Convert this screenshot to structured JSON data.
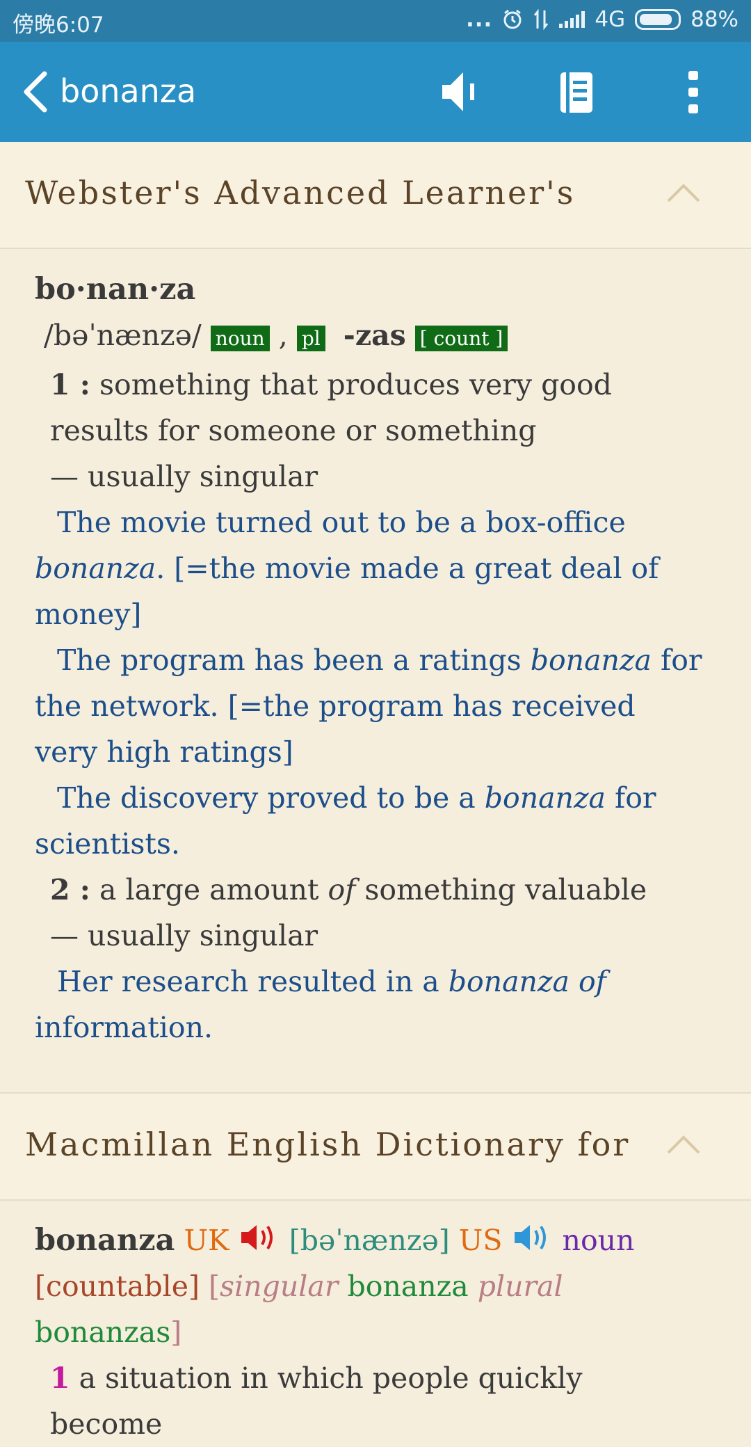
{
  "status": {
    "time": "傍晚6:07",
    "dots": "...",
    "network": "4G",
    "battery": "88%"
  },
  "appbar": {
    "title": "bonanza",
    "icons": [
      "back-icon",
      "speaker-icon",
      "list-icon",
      "more-icon"
    ]
  },
  "colors": {
    "status_bar": "#2b7ca6",
    "app_bar": "#2890c5",
    "background": "#f5eedd",
    "example_text": "#1c4e8a",
    "tag": "#0f6b16"
  },
  "webster": {
    "section_title": "Webster's Advanced Learner's",
    "headword": "bo·nan·za",
    "pronunciation": "/bəˈnænzə/",
    "pos": "noun",
    "comma": ",",
    "pl_tag": "pl",
    "plural_form": "-zas",
    "count_tag": "[ count ]",
    "sense1_num": "1 :",
    "sense1_def": "something that produces very good results for someone or something",
    "usage1": "— usually singular",
    "ex1a_pre": "The movie turned out to be a box-office ",
    "ex1a_italic": "bonanza",
    "ex1a_post": ". [=the movie made a great deal of money]",
    "ex1b_pre": "The program has been a ratings ",
    "ex1b_italic": "bonanza",
    "ex1b_post": " for the network. [=the program has received very high ratings]",
    "ex1c_pre": "The discovery proved to be a ",
    "ex1c_italic": "bonanza",
    "ex1c_post": " for scientists.",
    "sense2_num": "2 :",
    "sense2_pre": "a large amount ",
    "sense2_italic": "of",
    "sense2_post": " something valuable",
    "usage2": "— usually singular",
    "ex2_pre": "Her research resulted in a ",
    "ex2_italic": "bonanza of",
    "ex2_post": " information."
  },
  "macmillan": {
    "section_title": "Macmillan English Dictionary for",
    "headword": "bonanza",
    "uk_label": "UK",
    "uk_pron": "[bəˈnænzə]",
    "us_label": "US",
    "pos": "noun",
    "countable": "[countable]",
    "bracket_open": "[",
    "singular_label": "singular",
    "singular_form": "bonanza",
    "plural_label": "plural",
    "plural_form": "bonanzas",
    "bracket_close": "]",
    "sense1_num": "1",
    "sense1_def": "a situation in which people quickly become"
  }
}
